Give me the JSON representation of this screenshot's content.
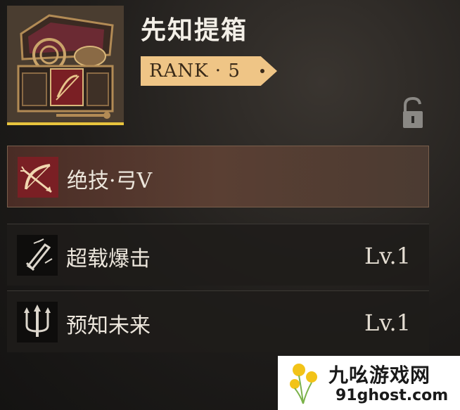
{
  "item": {
    "name": "先知提箱",
    "rank_label": "RANK · 5",
    "icon": "treasure-chest-icon",
    "locked": false
  },
  "skills": [
    {
      "name": "绝技·弓V",
      "level": "",
      "icon": "bow-arrow-icon",
      "selected": true
    },
    {
      "name": "超载爆击",
      "level": "Lv.1",
      "icon": "sword-strike-icon",
      "selected": false
    },
    {
      "name": "预知未来",
      "level": "Lv.1",
      "icon": "trident-icon",
      "selected": false
    }
  ],
  "watermark": {
    "site_name": "九吆游戏网",
    "url": "91ghost.com"
  },
  "colors": {
    "rank_bg": "#efc586",
    "accent_yellow": "#e8c43d",
    "selected_row": "#5a3f33",
    "bow_icon_bg": "#7a1f24"
  }
}
